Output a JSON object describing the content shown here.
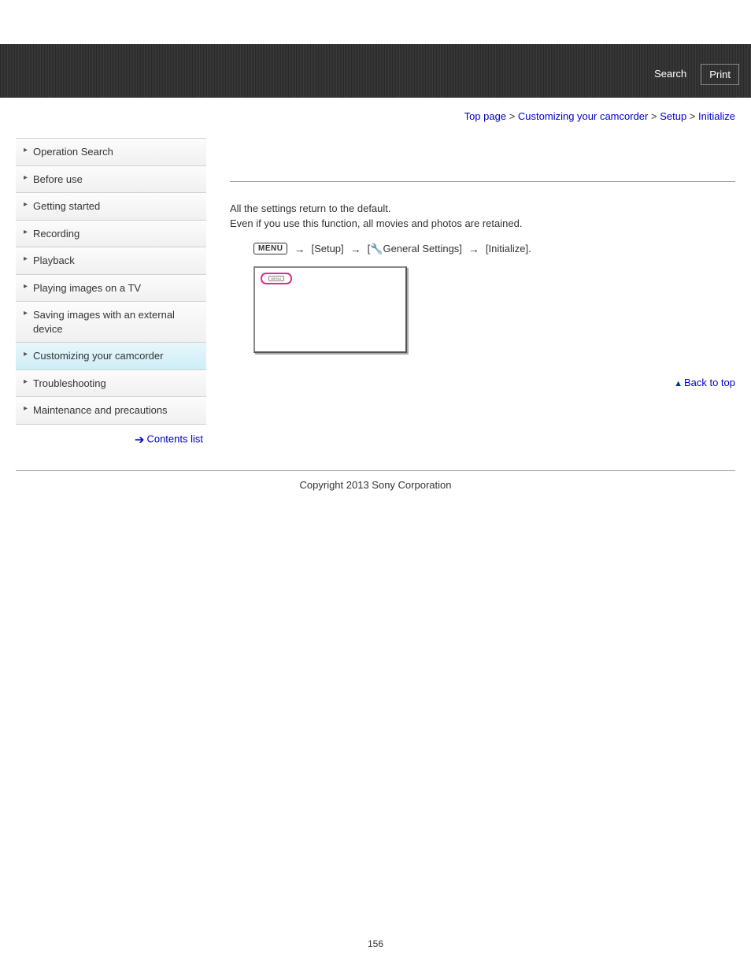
{
  "header": {
    "search": "Search",
    "print": "Print"
  },
  "breadcrumb": {
    "top_page": "Top page",
    "customizing": "Customizing your camcorder",
    "setup": "Setup",
    "initialize": "Initialize"
  },
  "sidebar": {
    "items": [
      {
        "label": "Operation Search",
        "active": false
      },
      {
        "label": "Before use",
        "active": false
      },
      {
        "label": "Getting started",
        "active": false
      },
      {
        "label": "Recording",
        "active": false
      },
      {
        "label": "Playback",
        "active": false
      },
      {
        "label": "Playing images on a TV",
        "active": false
      },
      {
        "label": "Saving images with an external device",
        "active": false
      },
      {
        "label": "Customizing your camcorder",
        "active": true
      },
      {
        "label": "Troubleshooting",
        "active": false
      },
      {
        "label": "Maintenance and precautions",
        "active": false
      }
    ],
    "contents_list": "Contents list"
  },
  "content": {
    "p1": "All the settings return to the default.",
    "p2": "Even if you use this function, all movies and photos are retained.",
    "menu_label": "MENU",
    "path_setup": "[Setup]",
    "path_general_prefix": "[",
    "path_general": "General Settings]",
    "path_initialize": "[Initialize].",
    "screen_menu": "MENU",
    "back_to_top": "Back to top"
  },
  "footer": {
    "copyright": "Copyright 2013 Sony Corporation",
    "page_number": "156"
  }
}
